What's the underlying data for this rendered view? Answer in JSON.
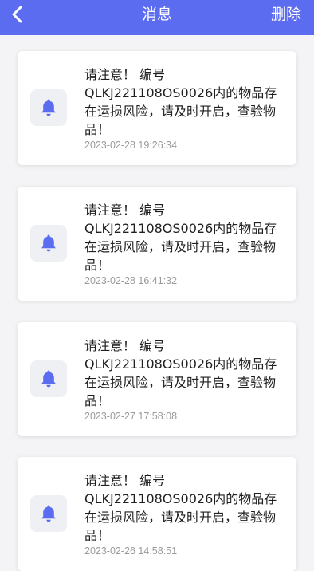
{
  "header": {
    "title": "消息",
    "delete_label": "删除",
    "back_icon": "chevron-left-icon",
    "background": "#5b6cf0"
  },
  "messages": [
    {
      "text_line1": "请注意！ 编号",
      "text_body": "QLKJ221108OS0026内的物品存在运损风险，请及时开启，查验物品！",
      "time": "2023-02-28 19:26:34",
      "icon": "bell-icon"
    },
    {
      "text_line1": "请注意！ 编号",
      "text_body": "QLKJ221108OS0026内的物品存在运损风险，请及时开启，查验物品！",
      "time": "2023-02-28 16:41:32",
      "icon": "bell-icon"
    },
    {
      "text_line1": "请注意！ 编号",
      "text_body": "QLKJ221108OS0026内的物品存在运损风险，请及时开启，查验物品！",
      "time": "2023-02-27 17:58:08",
      "icon": "bell-icon"
    },
    {
      "text_line1": "请注意！ 编号",
      "text_body": "QLKJ221108OS0026内的物品存在运损风险，请及时开启，查验物品！",
      "time": "2023-02-26 14:58:51",
      "icon": "bell-icon"
    }
  ],
  "colors": {
    "accent": "#5b6cf0",
    "bell": "#5b6cf0"
  }
}
